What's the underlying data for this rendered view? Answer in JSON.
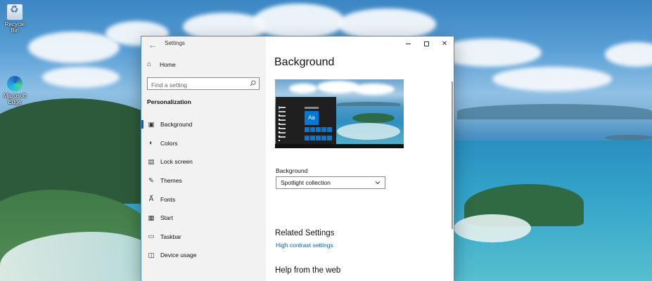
{
  "desktop": {
    "icons": [
      {
        "label": "Recycle Bin",
        "icon": "recycle-bin-icon"
      },
      {
        "label": "Microsoft Edge",
        "icon": "edge-icon"
      }
    ]
  },
  "window": {
    "title": "Settings",
    "back_icon": "back-arrow-icon",
    "controls": [
      "minimize",
      "maximize",
      "close"
    ]
  },
  "nav": {
    "home_label": "Home",
    "search_placeholder": "Find a setting",
    "section_label": "Personalization",
    "items": [
      {
        "label": "Background",
        "icon": "image-icon",
        "active": true
      },
      {
        "label": "Colors",
        "icon": "palette-icon",
        "active": false
      },
      {
        "label": "Lock screen",
        "icon": "lock-screen-icon",
        "active": false
      },
      {
        "label": "Themes",
        "icon": "brush-icon",
        "active": false
      },
      {
        "label": "Fonts",
        "icon": "font-icon",
        "active": false
      },
      {
        "label": "Start",
        "icon": "start-icon",
        "active": false
      },
      {
        "label": "Taskbar",
        "icon": "taskbar-icon",
        "active": false
      },
      {
        "label": "Device usage",
        "icon": "device-usage-icon",
        "active": false
      }
    ]
  },
  "content": {
    "title": "Background",
    "preview_tile_text": "Aa",
    "background_label": "Background",
    "background_value": "Spotlight collection",
    "related_heading": "Related Settings",
    "related_link": "High contrast settings",
    "help_heading": "Help from the web"
  },
  "colors": {
    "accent": "#0078d7",
    "link": "#0063b1",
    "nav_bg": "#f2f2f2"
  }
}
